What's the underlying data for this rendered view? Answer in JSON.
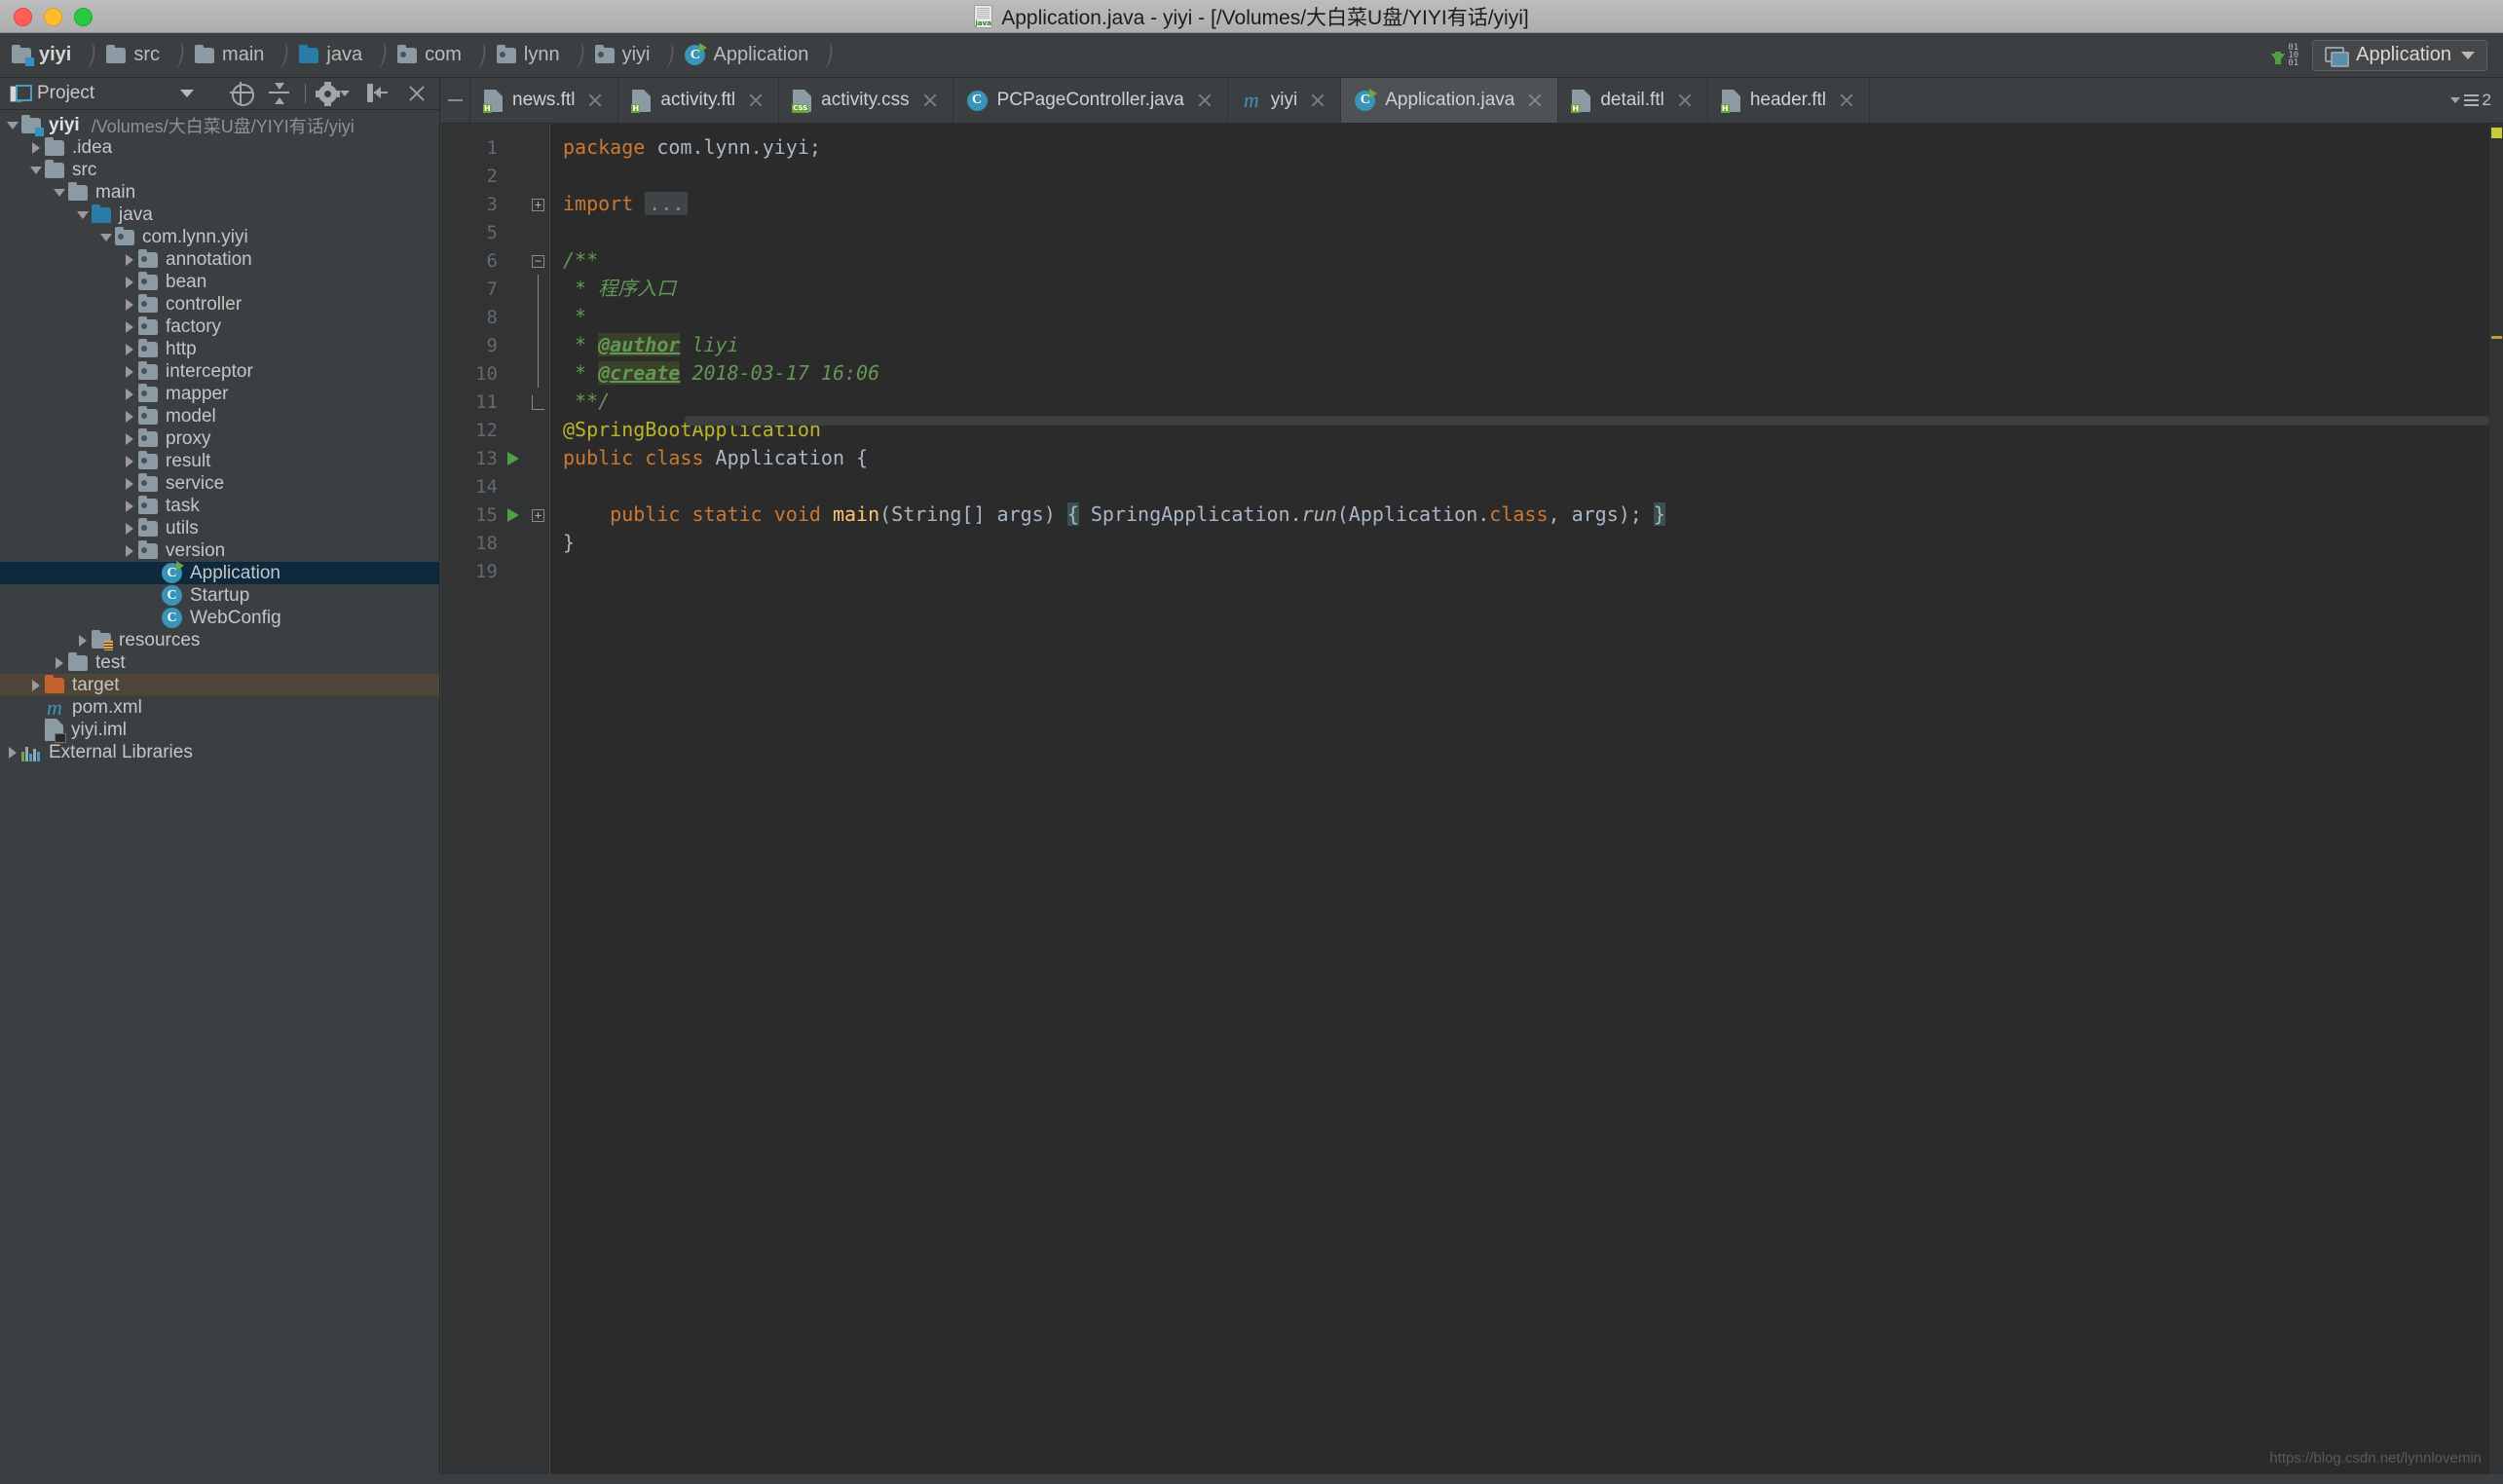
{
  "window": {
    "title": "Application.java - yiyi - [/Volumes/大白菜U盘/YIYI有话/yiyi]",
    "title_icon": "java-file-icon"
  },
  "breadcrumb": {
    "items": [
      {
        "label": "yiyi",
        "icon": "module-folder-icon"
      },
      {
        "label": "src",
        "icon": "folder-icon"
      },
      {
        "label": "main",
        "icon": "folder-icon"
      },
      {
        "label": "java",
        "icon": "source-root-folder-icon"
      },
      {
        "label": "com",
        "icon": "package-icon"
      },
      {
        "label": "lynn",
        "icon": "package-icon"
      },
      {
        "label": "yiyi",
        "icon": "package-icon"
      },
      {
        "label": "Application",
        "icon": "java-class-icon"
      }
    ]
  },
  "toolbar_right": {
    "bits_label_top": "01",
    "bits_label_mid": "10",
    "bits_label_bot": "01",
    "run_config": "Application"
  },
  "project_panel": {
    "title": "Project",
    "tools": [
      {
        "name": "locate-in-tree-icon"
      },
      {
        "name": "collapse-all-icon"
      },
      {
        "name": "settings-gear-icon"
      },
      {
        "name": "hide-panel-icon"
      },
      {
        "name": "close-panel-icon"
      }
    ],
    "tree": [
      {
        "indent": 0,
        "arrow": "down",
        "icon": "module-folder-icon",
        "label": "yiyi",
        "bold": true,
        "path": "/Volumes/大白菜U盘/YIYI有话/yiyi"
      },
      {
        "indent": 1,
        "arrow": "right",
        "icon": "folder-icon",
        "label": ".idea"
      },
      {
        "indent": 1,
        "arrow": "down",
        "icon": "folder-icon",
        "label": "src"
      },
      {
        "indent": 2,
        "arrow": "down",
        "icon": "folder-icon",
        "label": "main"
      },
      {
        "indent": 3,
        "arrow": "down",
        "icon": "source-root-folder-icon",
        "label": "java"
      },
      {
        "indent": 4,
        "arrow": "down",
        "icon": "package-folder-icon",
        "label": "com.lynn.yiyi"
      },
      {
        "indent": 5,
        "arrow": "right",
        "icon": "package-folder-icon",
        "label": "annotation"
      },
      {
        "indent": 5,
        "arrow": "right",
        "icon": "package-folder-icon",
        "label": "bean"
      },
      {
        "indent": 5,
        "arrow": "right",
        "icon": "package-folder-icon",
        "label": "controller"
      },
      {
        "indent": 5,
        "arrow": "right",
        "icon": "package-folder-icon",
        "label": "factory"
      },
      {
        "indent": 5,
        "arrow": "right",
        "icon": "package-folder-icon",
        "label": "http"
      },
      {
        "indent": 5,
        "arrow": "right",
        "icon": "package-folder-icon",
        "label": "interceptor"
      },
      {
        "indent": 5,
        "arrow": "right",
        "icon": "package-folder-icon",
        "label": "mapper"
      },
      {
        "indent": 5,
        "arrow": "right",
        "icon": "package-folder-icon",
        "label": "model"
      },
      {
        "indent": 5,
        "arrow": "right",
        "icon": "package-folder-icon",
        "label": "proxy"
      },
      {
        "indent": 5,
        "arrow": "right",
        "icon": "package-folder-icon",
        "label": "result"
      },
      {
        "indent": 5,
        "arrow": "right",
        "icon": "package-folder-icon",
        "label": "service"
      },
      {
        "indent": 5,
        "arrow": "right",
        "icon": "package-folder-icon",
        "label": "task"
      },
      {
        "indent": 5,
        "arrow": "right",
        "icon": "package-folder-icon",
        "label": "utils"
      },
      {
        "indent": 5,
        "arrow": "right",
        "icon": "package-folder-icon",
        "label": "version"
      },
      {
        "indent": 6,
        "arrow": "none",
        "icon": "java-runnable-class-icon",
        "label": "Application",
        "selected": true
      },
      {
        "indent": 6,
        "arrow": "none",
        "icon": "java-class-icon",
        "label": "Startup"
      },
      {
        "indent": 6,
        "arrow": "none",
        "icon": "java-class-icon",
        "label": "WebConfig"
      },
      {
        "indent": 3,
        "arrow": "right",
        "icon": "resources-folder-icon",
        "label": "resources"
      },
      {
        "indent": 2,
        "arrow": "right",
        "icon": "folder-icon",
        "label": "test"
      },
      {
        "indent": 1,
        "arrow": "right",
        "icon": "excluded-folder-icon",
        "label": "target",
        "excluded": true
      },
      {
        "indent": 1,
        "arrow": "none",
        "icon": "maven-icon",
        "label": "pom.xml"
      },
      {
        "indent": 1,
        "arrow": "none",
        "icon": "iml-file-icon",
        "label": "yiyi.iml"
      },
      {
        "indent": 0,
        "arrow": "right",
        "icon": "external-libraries-icon",
        "label": "External Libraries"
      }
    ]
  },
  "editor": {
    "tabs": [
      {
        "label": "news.ftl",
        "icon": "ftl-file-icon",
        "badge": "H",
        "active": false
      },
      {
        "label": "activity.ftl",
        "icon": "ftl-file-icon",
        "badge": "H",
        "active": false
      },
      {
        "label": "activity.css",
        "icon": "css-file-icon",
        "badge": "CSS",
        "active": false
      },
      {
        "label": "PCPageController.java",
        "icon": "java-class-icon",
        "badge": "",
        "active": false
      },
      {
        "label": "yiyi",
        "icon": "maven-icon",
        "badge": "",
        "active": false
      },
      {
        "label": "Application.java",
        "icon": "java-runnable-class-icon",
        "badge": "",
        "active": true
      },
      {
        "label": "detail.ftl",
        "icon": "ftl-file-icon",
        "badge": "H",
        "active": false
      },
      {
        "label": "header.ftl",
        "icon": "ftl-file-icon",
        "badge": "H",
        "active": false
      }
    ],
    "tab_overflow_count": "2",
    "line_numbers": [
      "1",
      "2",
      "3",
      "5",
      "6",
      "7",
      "8",
      "9",
      "10",
      "11",
      "12",
      "13",
      "14",
      "15",
      "18",
      "19"
    ],
    "code_lines": [
      {
        "n": "1",
        "html": "<span class=\"kw\">package</span> com.lynn.yiyi;"
      },
      {
        "n": "2",
        "html": ""
      },
      {
        "n": "3",
        "html": "<span class=\"kw\">import</span> <span class=\"fold-dots\">...</span>"
      },
      {
        "n": "5",
        "html": ""
      },
      {
        "n": "6",
        "html": "<span class=\"cmt\">/**</span>"
      },
      {
        "n": "7",
        "html": "<span class=\"cmt\"> * 程序入口</span>"
      },
      {
        "n": "8",
        "html": "<span class=\"cmt\"> *</span>"
      },
      {
        "n": "9",
        "html": "<span class=\"cmt\"> * </span><span class=\"tag\">@author</span><span class=\"cmt\"> liyi</span>"
      },
      {
        "n": "10",
        "html": "<span class=\"cmt\"> * </span><span class=\"tag\">@create</span><span class=\"cmt\"> 2018-03-17 16:06</span>"
      },
      {
        "n": "11",
        "html": "<span class=\"cmt\"> **/</span>"
      },
      {
        "n": "12",
        "html": "<span class=\"anno\">@SpringBootApplication</span>"
      },
      {
        "n": "13",
        "html": "<span class=\"kw\">public class</span> <span class=\"cls\">Application</span> {"
      },
      {
        "n": "14",
        "html": ""
      },
      {
        "n": "15",
        "html": "    <span class=\"kw\">public static void</span> <span class=\"mth\">main</span>(String[] args) <span class=\"brace-hl\">{</span> SpringApplication.<span class=\"fld\">run</span>(Application.<span class=\"kw\">class</span>, args); <span class=\"brace-hl\">}</span>"
      },
      {
        "n": "18",
        "html": "}"
      },
      {
        "n": "19",
        "html": ""
      }
    ],
    "plain_code": [
      "package com.lynn.yiyi;",
      "",
      "import ...",
      "",
      "/**",
      " * 程序入口",
      " *",
      " * @author liyi",
      " * @create 2018-03-17 16:06",
      " **/",
      "@SpringBootApplication",
      "public class Application {",
      "",
      "    public static void main(String[] args) { SpringApplication.run(Application.class, args); }",
      "}",
      ""
    ],
    "watermark": "https://blog.csdn.net/lynnlovemin"
  },
  "colors": {
    "accent_blue": "#3a94b8",
    "selection": "#0d293e",
    "excluded": "#4e4437",
    "editor_bg": "#2b2b2b",
    "panel_bg": "#3c3f41",
    "keyword": "#cc7832",
    "comment": "#629755",
    "annotation": "#bbb529",
    "method": "#ffc66d",
    "text": "#a9b7c6"
  }
}
